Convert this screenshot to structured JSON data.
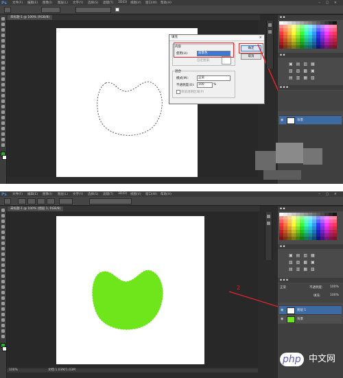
{
  "app": {
    "logo": "Ps"
  },
  "menu": [
    "文件(F)",
    "编辑(E)",
    "图像(I)",
    "图层(L)",
    "文字(Y)",
    "选择(S)",
    "滤镜(T)",
    "3D(D)",
    "视图(V)",
    "窗口(W)",
    "帮助(H)"
  ],
  "top": {
    "document_tab": "未标题-1 @ 100% (RGB/8)",
    "dialog": {
      "title": "填充",
      "content_group": "内容",
      "use_label": "使用(U):",
      "use_value": "前景色",
      "custom_pattern_label": "自定图案:",
      "blending_group": "混合",
      "mode_label": "模式(M):",
      "mode_value": "正常",
      "opacity_label": "不透明度(O):",
      "opacity_value": "100",
      "opacity_unit": "%",
      "preserve_label": "保留透明区域(P)",
      "ok_label": "确定",
      "cancel_label": "取消",
      "close_glyph": "×"
    },
    "layers": [
      {
        "name": "背景",
        "active": true
      }
    ]
  },
  "bottom": {
    "document_tab": "未标题-1 @ 100% (图层 1, RGB/8)",
    "annotation": "2",
    "zoom": "100%",
    "doc_info": "文档:1.03M/1.03M",
    "layers": [
      {
        "name": "图层 1",
        "active": true
      },
      {
        "name": "背景",
        "active": false
      }
    ],
    "opacity_label": "不透明度:",
    "opacity_value": "100%",
    "fill_label": "填充:",
    "fill_value": "100%",
    "blend_mode": "正常"
  },
  "fill_color": "#6fe61c",
  "accent_red": "#e8262a",
  "watermark": {
    "brand": "php",
    "site": "中文网"
  }
}
